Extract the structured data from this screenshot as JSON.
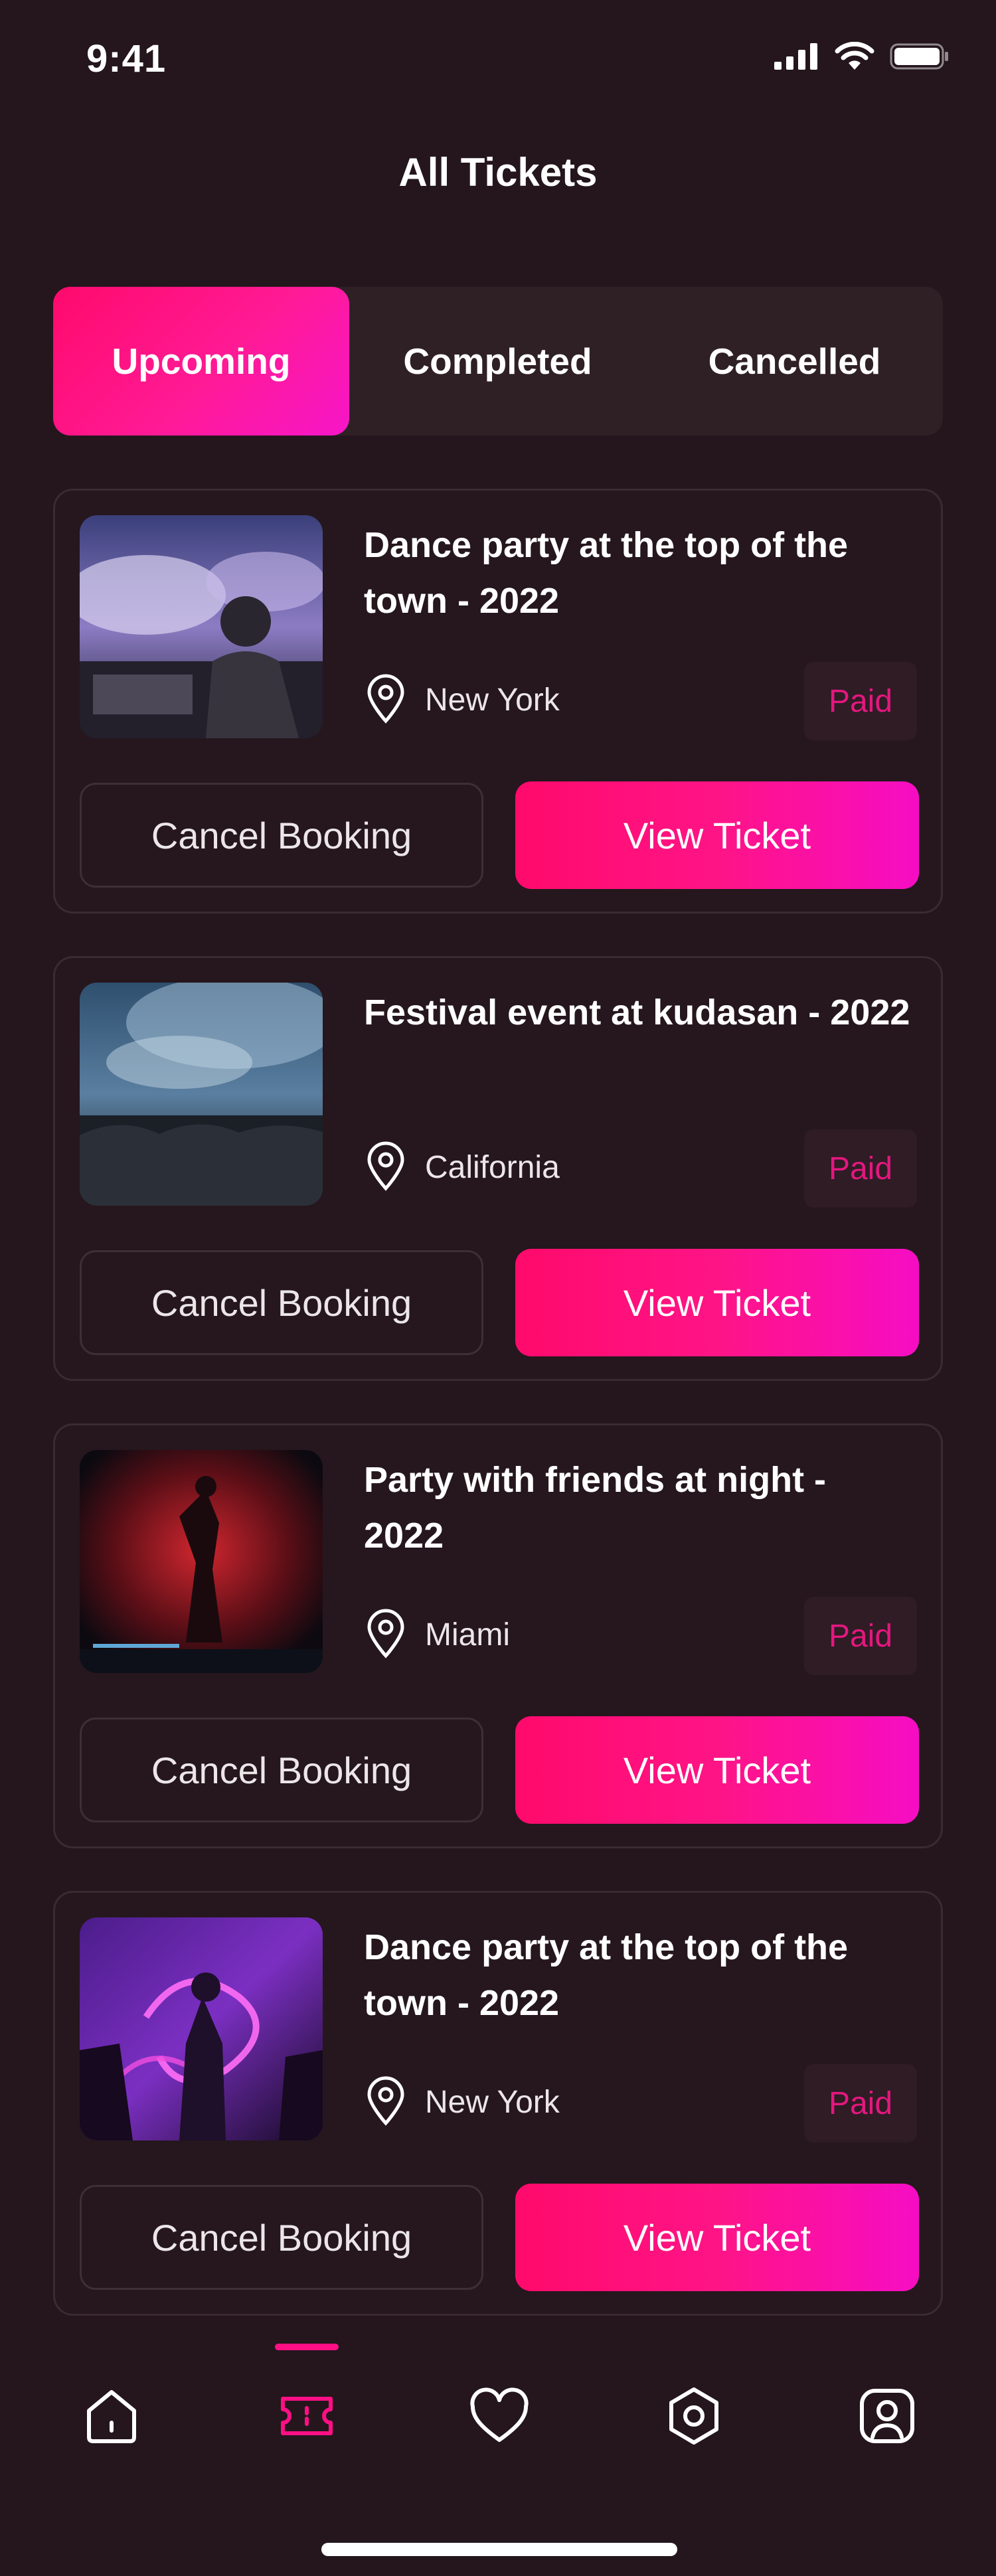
{
  "status_bar": {
    "time": "9:41"
  },
  "header": {
    "title": "All Tickets"
  },
  "tabs": [
    {
      "label": "Upcoming",
      "active": true
    },
    {
      "label": "Completed",
      "active": false
    },
    {
      "label": "Cancelled",
      "active": false
    }
  ],
  "tickets": [
    {
      "title": "Dance party at the top of the town - 2022",
      "location": "New York",
      "status": "Paid",
      "cancel_label": "Cancel Booking",
      "view_label": "View Ticket"
    },
    {
      "title": "Festival event at kudasan - 2022",
      "location": "California",
      "status": "Paid",
      "cancel_label": "Cancel Booking",
      "view_label": "View Ticket"
    },
    {
      "title": "Party with friends at night - 2022",
      "location": "Miami",
      "status": "Paid",
      "cancel_label": "Cancel Booking",
      "view_label": "View Ticket"
    },
    {
      "title": "Dance party at the top of the town - 2022",
      "location": "New York",
      "status": "Paid",
      "cancel_label": "Cancel Booking",
      "view_label": "View Ticket"
    }
  ],
  "bottom_nav": [
    {
      "icon": "home-icon",
      "active": false
    },
    {
      "icon": "ticket-icon",
      "active": true
    },
    {
      "icon": "heart-icon",
      "active": false
    },
    {
      "icon": "settings-icon",
      "active": false
    },
    {
      "icon": "profile-icon",
      "active": false
    }
  ],
  "colors": {
    "background": "#24161c",
    "accent": "#ff0f85",
    "accent_gradient_end": "#f60dc4",
    "card_border": "#3a2a31",
    "paid_text": "#e4177f"
  }
}
